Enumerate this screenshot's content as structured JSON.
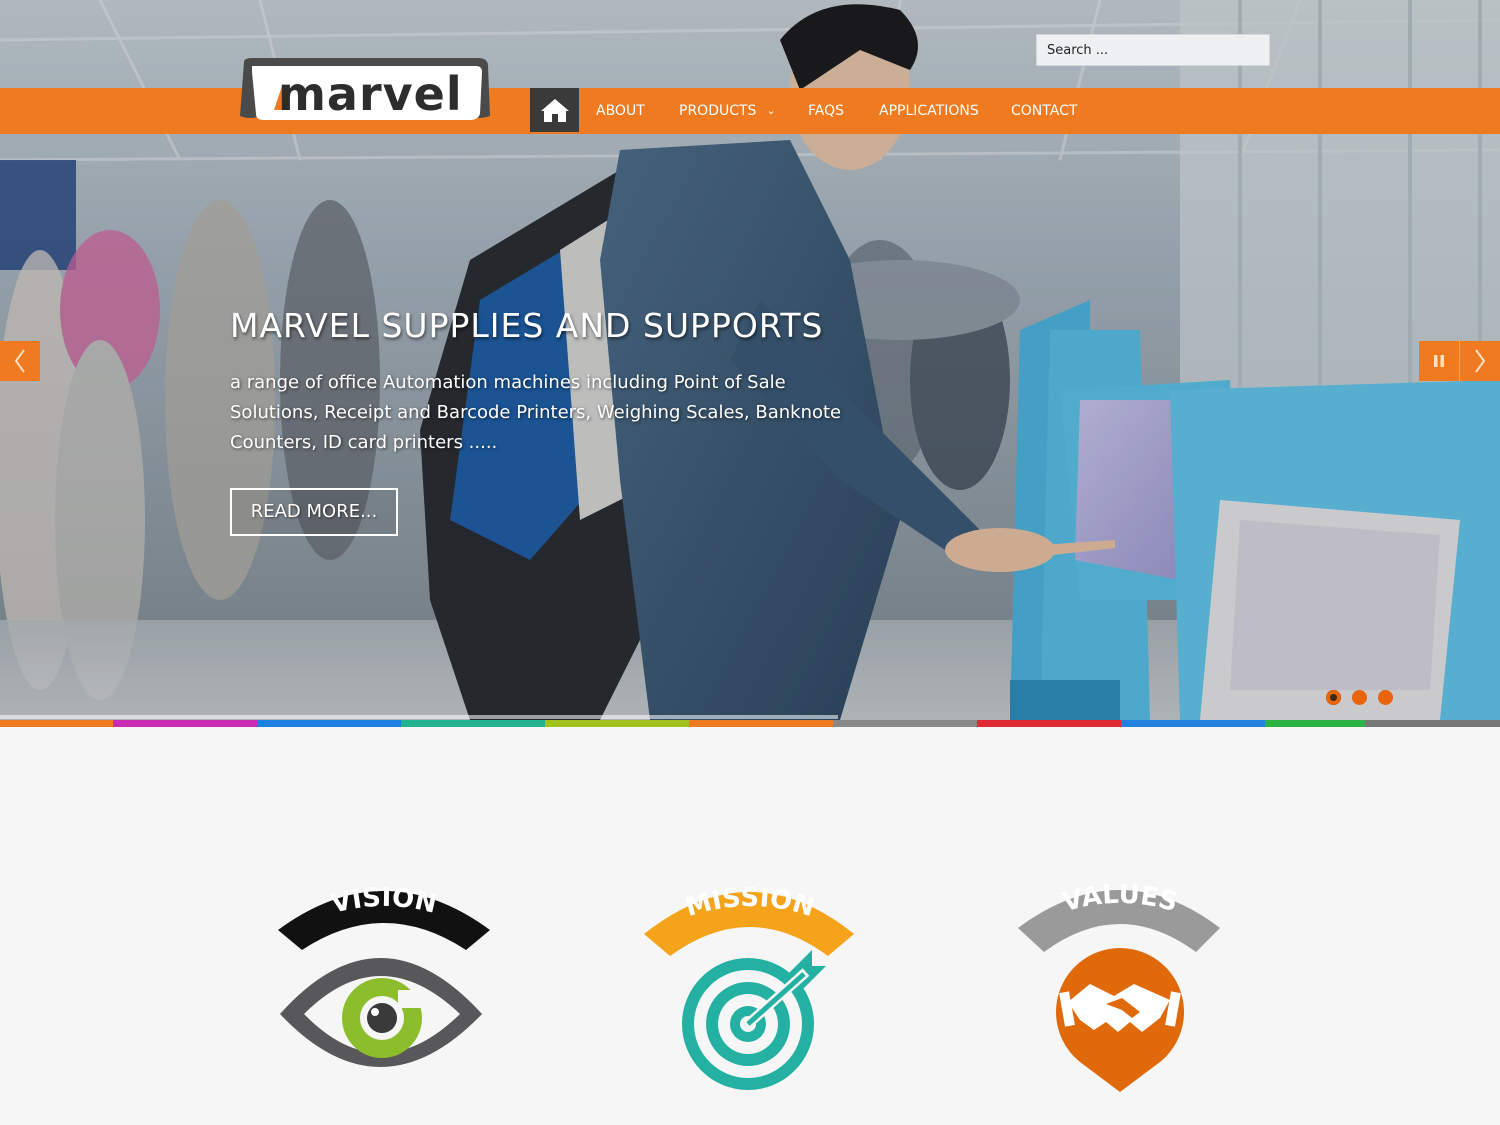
{
  "header": {
    "logo_text": "marvel",
    "search_placeholder": "Search ..."
  },
  "nav": {
    "items": [
      {
        "label": "ABOUT"
      },
      {
        "label": "PRODUCTS"
      },
      {
        "label": "FAQS"
      },
      {
        "label": "APPLICATIONS"
      },
      {
        "label": "CONTACT"
      }
    ]
  },
  "slider": {
    "title": "MARVEL SUPPLIES AND SUPPORTS",
    "text": "a range of office Automation machines including Point of Sale Solutions, Receipt and Barcode Printers, Weighing Scales, Banknote Counters, ID card printers .....",
    "button_label": "READ MORE...",
    "slide_count": 3,
    "active_slide": 1
  },
  "features": {
    "items": [
      {
        "label": "VISION"
      },
      {
        "label": "MISSION"
      },
      {
        "label": "VALUES"
      }
    ]
  },
  "colors": {
    "accent": "#ef7a1f",
    "dark": "#3a3a3a",
    "strip": [
      "#ef7a1f",
      "#c92cb3",
      "#1f7fe0",
      "#20b58f",
      "#9fc21e",
      "#ef7a1f",
      "#888888",
      "#e02a33",
      "#2383dc",
      "#2cb345",
      "#777777"
    ]
  }
}
